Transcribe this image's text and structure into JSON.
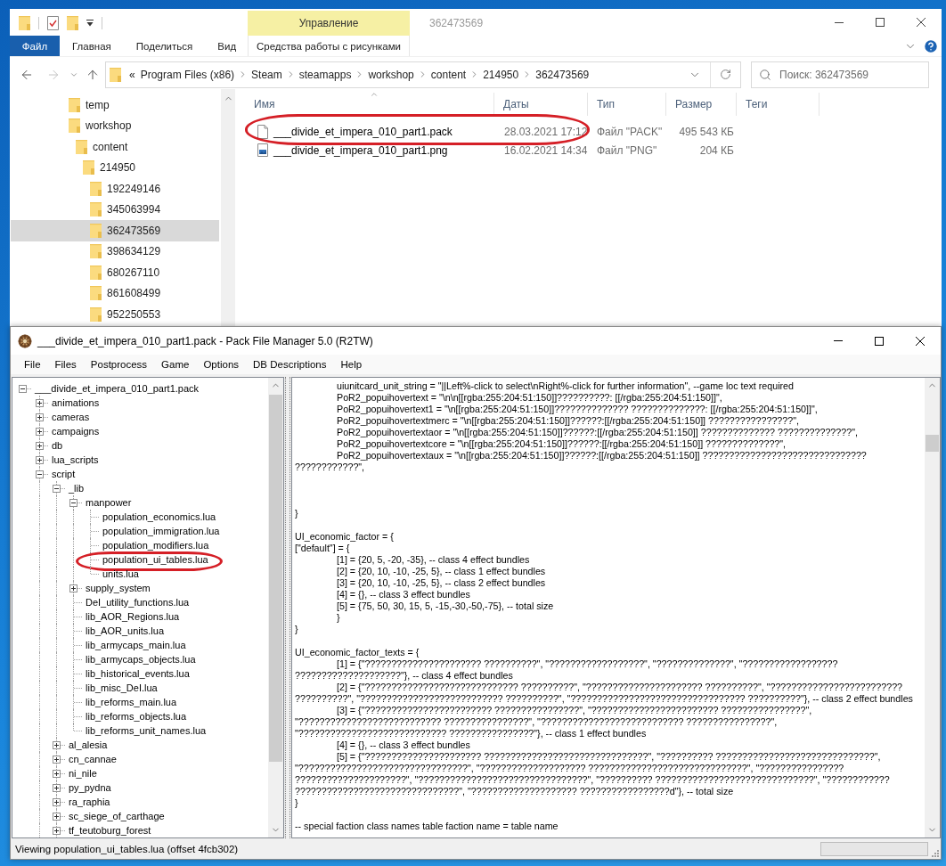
{
  "explorer": {
    "title": "362473569",
    "contextual_group": "Управление",
    "ribbon_tabs": [
      {
        "label": "Файл",
        "kind": "file",
        "selected": false
      },
      {
        "label": "Главная",
        "kind": "normal",
        "selected": false
      },
      {
        "label": "Поделиться",
        "kind": "normal",
        "selected": false
      },
      {
        "label": "Вид",
        "kind": "normal",
        "selected": false
      },
      {
        "label": "Средства работы с рисунками",
        "kind": "contextual",
        "selected": false
      }
    ],
    "back": {
      "disabled": false
    },
    "forward": {
      "disabled": true
    },
    "address": {
      "overflow_mark": "«",
      "crumbs": [
        "Program Files (x86)",
        "Steam",
        "steamapps",
        "workshop",
        "content",
        "214950",
        "362473569"
      ]
    },
    "search": {
      "placeholder": "Поиск: 362473569"
    },
    "nav_tree": [
      {
        "label": "temp",
        "selected": false
      },
      {
        "label": "workshop",
        "selected": false,
        "children": [
          {
            "label": "content",
            "selected": false,
            "children": [
              {
                "label": "214950",
                "selected": false,
                "children": [
                  {
                    "label": "192249146",
                    "selected": false
                  },
                  {
                    "label": "345063994",
                    "selected": false
                  },
                  {
                    "label": "362473569",
                    "selected": true
                  },
                  {
                    "label": "398634129",
                    "selected": false
                  },
                  {
                    "label": "680267110",
                    "selected": false
                  },
                  {
                    "label": "861608499",
                    "selected": false
                  },
                  {
                    "label": "952250553",
                    "selected": false
                  }
                ]
              }
            ]
          }
        ]
      }
    ],
    "columns": [
      {
        "label": "Имя",
        "sorted": true
      },
      {
        "label": "Даты",
        "sorted": false
      },
      {
        "label": "Тип",
        "sorted": false
      },
      {
        "label": "Размер",
        "sorted": false
      },
      {
        "label": "Теги",
        "sorted": false
      }
    ],
    "files": [
      {
        "name": "___divide_et_impera_010_part1.pack",
        "date": "28.03.2021 17:12",
        "type": "Файл \"PACK\"",
        "size": "495 543 КБ",
        "kind": "document",
        "highlighted": true
      },
      {
        "name": "___divide_et_impera_010_part1.png",
        "date": "16.02.2021 14:34",
        "type": "Файл \"PNG\"",
        "size": "204 КБ",
        "kind": "image",
        "highlighted": false
      }
    ]
  },
  "pfm": {
    "title": "___divide_et_impera_010_part1.pack - Pack File Manager 5.0 (R2TW)",
    "menu": [
      "File",
      "Files",
      "Postprocess",
      "Game",
      "Options",
      "DB Descriptions",
      "Help"
    ],
    "tree": [
      {
        "label": "___divide_et_impera_010_part1.pack",
        "kind": "folder",
        "expanded": true,
        "highlighted": false,
        "children": [
          {
            "label": "animations",
            "kind": "folder",
            "expanded": false,
            "highlighted": false
          },
          {
            "label": "cameras",
            "kind": "folder",
            "expanded": false,
            "highlighted": false
          },
          {
            "label": "campaigns",
            "kind": "folder",
            "expanded": false,
            "highlighted": false
          },
          {
            "label": "db",
            "kind": "folder",
            "expanded": false,
            "highlighted": false
          },
          {
            "label": "lua_scripts",
            "kind": "folder",
            "expanded": false,
            "highlighted": false
          },
          {
            "label": "script",
            "kind": "folder",
            "expanded": true,
            "highlighted": false,
            "children": [
              {
                "label": "_lib",
                "kind": "folder",
                "expanded": true,
                "highlighted": false,
                "children": [
                  {
                    "label": "manpower",
                    "kind": "folder",
                    "expanded": true,
                    "highlighted": false,
                    "children": [
                      {
                        "label": "population_economics.lua",
                        "kind": "file",
                        "highlighted": false
                      },
                      {
                        "label": "population_immigration.lua",
                        "kind": "file",
                        "highlighted": false
                      },
                      {
                        "label": "population_modifiers.lua",
                        "kind": "file",
                        "highlighted": false
                      },
                      {
                        "label": "population_ui_tables.lua",
                        "kind": "file",
                        "highlighted": true
                      },
                      {
                        "label": "units.lua",
                        "kind": "file",
                        "highlighted": false
                      }
                    ]
                  },
                  {
                    "label": "supply_system",
                    "kind": "folder",
                    "expanded": false,
                    "highlighted": false
                  },
                  {
                    "label": "DeI_utility_functions.lua",
                    "kind": "file",
                    "highlighted": false
                  },
                  {
                    "label": "lib_AOR_Regions.lua",
                    "kind": "file",
                    "highlighted": false
                  },
                  {
                    "label": "lib_AOR_units.lua",
                    "kind": "file",
                    "highlighted": false
                  },
                  {
                    "label": "lib_armycaps_main.lua",
                    "kind": "file",
                    "highlighted": false
                  },
                  {
                    "label": "lib_armycaps_objects.lua",
                    "kind": "file",
                    "highlighted": false
                  },
                  {
                    "label": "lib_historical_events.lua",
                    "kind": "file",
                    "highlighted": false
                  },
                  {
                    "label": "lib_misc_DeI.lua",
                    "kind": "file",
                    "highlighted": false
                  },
                  {
                    "label": "lib_reforms_main.lua",
                    "kind": "file",
                    "highlighted": false
                  },
                  {
                    "label": "lib_reforms_objects.lua",
                    "kind": "file",
                    "highlighted": false
                  },
                  {
                    "label": "lib_reforms_unit_names.lua",
                    "kind": "file",
                    "highlighted": false
                  }
                ]
              },
              {
                "label": "al_alesia",
                "kind": "folder",
                "expanded": false,
                "highlighted": false
              },
              {
                "label": "cn_cannae",
                "kind": "folder",
                "expanded": false,
                "highlighted": false
              },
              {
                "label": "ni_nile",
                "kind": "folder",
                "expanded": false,
                "highlighted": false
              },
              {
                "label": "py_pydna",
                "kind": "folder",
                "expanded": false,
                "highlighted": false
              },
              {
                "label": "ra_raphia",
                "kind": "folder",
                "expanded": false,
                "highlighted": false
              },
              {
                "label": "sc_siege_of_carthage",
                "kind": "folder",
                "expanded": false,
                "highlighted": false
              },
              {
                "label": "tf_teutoburg_forest",
                "kind": "folder",
                "expanded": false,
                "highlighted": false
              }
            ]
          }
        ]
      }
    ],
    "code_lines": [
      {
        "kind": "text",
        "indented": true,
        "text": "uiunitcard_unit_string = \"||Left%-click to select\\nRight%-click for further information\", --game loc text required"
      },
      {
        "kind": "text",
        "indented": true,
        "text": "PoR2_popuihovertext = \"\\n\\n[[rgba:255:204:51:150]]??????????: [[/rgba:255:204:51:150]]\","
      },
      {
        "kind": "text",
        "indented": true,
        "text": "PoR2_popuihovertext1 = \"\\n[[rgba:255:204:51:150]]?????????????? ??????????????: [[/rgba:255:204:51:150]]\","
      },
      {
        "kind": "text",
        "indented": true,
        "text": "PoR2_popuihovertextmerc = \"\\n[[rgba:255:204:51:150]]??????:[[/rgba:255:204:51:150]] ????????????????\","
      },
      {
        "kind": "text",
        "indented": true,
        "text": "PoR2_popuihovertextaor = \"\\n[[rgba:255:204:51:150]]??????:[[/rgba:255:204:51:150]] ?????????????? ??????????????\","
      },
      {
        "kind": "text",
        "indented": true,
        "text": "PoR2_popuihovertextcore = \"\\n[[rgba:255:204:51:150]]??????:[[/rgba:255:204:51:150]] ??????????????\","
      },
      {
        "kind": "text",
        "indented": true,
        "text": "PoR2_popuihovertextaux = \"\\n[[rgba:255:204:51:150]]??????:[[/rgba:255:204:51:150]] ???????????????????????????????"
      },
      {
        "kind": "text",
        "indented": false,
        "text": "????????????\","
      },
      {
        "kind": "blank"
      },
      {
        "kind": "blank"
      },
      {
        "kind": "blank"
      },
      {
        "kind": "text",
        "indented": false,
        "text": "}"
      },
      {
        "kind": "blank"
      },
      {
        "kind": "text",
        "indented": false,
        "text": "UI_economic_factor = {"
      },
      {
        "kind": "text",
        "indented": false,
        "text": "[\"default\"] = {"
      },
      {
        "kind": "text",
        "indented": true,
        "text": "[1] = {20, 5, -20, -35}, -- class 4 effect bundles"
      },
      {
        "kind": "text",
        "indented": true,
        "text": "[2] = {20, 10, -10, -25, 5}, -- class 1 effect bundles"
      },
      {
        "kind": "text",
        "indented": true,
        "text": "[3] = {20, 10, -10, -25, 5}, -- class 2 effect bundles"
      },
      {
        "kind": "text",
        "indented": true,
        "text": "[4] = {}, -- class 3 effect bundles"
      },
      {
        "kind": "text",
        "indented": true,
        "text": "[5] = {75, 50, 30, 15, 5, -15,-30,-50,-75}, -- total size"
      },
      {
        "kind": "text",
        "indented": true,
        "text": "}"
      },
      {
        "kind": "text",
        "indented": false,
        "text": "}"
      },
      {
        "kind": "blank"
      },
      {
        "kind": "text",
        "indented": false,
        "text": "UI_economic_factor_texts = {"
      },
      {
        "kind": "text",
        "indented": true,
        "text": "[1] = {\"?????????????????????? ??????????\", \"??????????????????\", \"??????????????\", \"??????????????????"
      },
      {
        "kind": "text",
        "indented": false,
        "text": "????????????????????\"}, -- class 4 effect bundles"
      },
      {
        "kind": "text",
        "indented": true,
        "text": "[2] = {\"????????????????????????????? ??????????\", \"?????????????????????? ??????????\", \"?????????????????????????"
      },
      {
        "kind": "text",
        "indented": false,
        "text": "??????????\", \"??????????????????????????? ??????????\", \"????????????????????????????????? ??????????\"}, -- class 2 effect bundles"
      },
      {
        "kind": "text",
        "indented": true,
        "text": "[3] = {\"???????????????????????? ????????????????\", \"???????????????????????? ????????????????\","
      },
      {
        "kind": "text",
        "indented": false,
        "text": "\"??????????????????????????? ????????????????\", \"??????????????????????????? ????????????????\","
      },
      {
        "kind": "text",
        "indented": false,
        "text": "\"???????????????????????????? ????????????????\"}, -- class 1 effect bundles"
      },
      {
        "kind": "text",
        "indented": true,
        "text": "[4] = {}, -- class 3 effect bundles"
      },
      {
        "kind": "text",
        "indented": true,
        "text": "[5] = {\"?????????????????????? ???????????????????????????????\", \"?????????? ??????????????????????????????\","
      },
      {
        "kind": "text",
        "indented": false,
        "text": "\"????????????????????????????????\", \"???????????????????? ??????????????????????????????\", \"????????????????"
      },
      {
        "kind": "text",
        "indented": false,
        "text": "?????????????????????\", \"????????????????????????????????\", \"?????????? ??????????????????????????????\", \"????????????"
      },
      {
        "kind": "text",
        "indented": false,
        "text": "???????????????????????????????\", \"???????????????????? ?????????????????d\"}, -- total size"
      },
      {
        "kind": "text",
        "indented": false,
        "text": "}"
      },
      {
        "kind": "blank"
      },
      {
        "kind": "text",
        "indented": false,
        "text": "-- special faction class names table faction name = table name"
      }
    ],
    "status": "Viewing population_ui_tables.lua (offset 4fcb302)"
  }
}
